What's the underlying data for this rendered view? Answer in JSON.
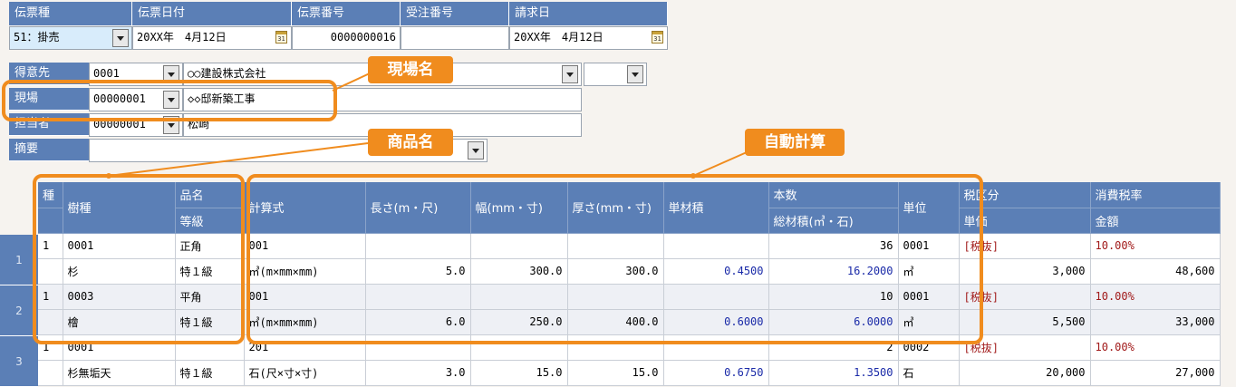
{
  "header": {
    "labels": [
      "伝票種",
      "伝票日付",
      "伝票番号",
      "受注番号",
      "請求日"
    ],
    "slip_type": "51：掛売",
    "slip_date": "20XX年　4月12日",
    "slip_number": "0000000016",
    "order_number": "",
    "billing_date": "20XX年　4月12日",
    "calendar_glyph": "31"
  },
  "info": {
    "customer_label": "得意先",
    "customer_code": "0001",
    "customer_name": "○○建設株式会社",
    "site_label": "現場",
    "site_code": "00000001",
    "site_name": "◇◇邸新築工事",
    "staff_label": "担当者",
    "staff_code": "00000001",
    "staff_name": "松崎",
    "memo_label": "摘要",
    "memo_value": ""
  },
  "grid": {
    "headers": {
      "kind": "種",
      "species": "樹種",
      "item_name": "品名",
      "grade": "等級",
      "formula": "計算式",
      "length": "長さ(m・尺)",
      "width": "幅(mm・寸)",
      "thickness": "厚さ(mm・寸)",
      "unit_volume": "単材積",
      "quantity": "本数",
      "total_volume": "総材積(㎥・石)",
      "unit": "単位",
      "tax_class": "税区分",
      "unit_price": "単価",
      "tax_rate": "消費税率",
      "amount": "金額"
    },
    "rows": [
      {
        "num": "1",
        "kind": "1",
        "code": "0001",
        "item_name": "正角",
        "formula_code": "001",
        "quantity": "36",
        "unit_code": "0001",
        "tax_class": "[税抜]",
        "tax_rate": "10.00%",
        "species": "杉",
        "grade": "特１級",
        "formula": "㎥(m×mm×mm)",
        "length": "5.0",
        "width": "300.0",
        "thickness": "300.0",
        "unit_volume": "0.4500",
        "total_volume": "16.2000",
        "unit": "㎥",
        "unit_price": "3,000",
        "amount": "48,600"
      },
      {
        "num": "2",
        "kind": "1",
        "code": "0003",
        "item_name": "平角",
        "formula_code": "001",
        "quantity": "10",
        "unit_code": "0001",
        "tax_class": "[税抜]",
        "tax_rate": "10.00%",
        "species": "檜",
        "grade": "特１級",
        "formula": "㎥(m×mm×mm)",
        "length": "6.0",
        "width": "250.0",
        "thickness": "400.0",
        "unit_volume": "0.6000",
        "total_volume": "6.0000",
        "unit": "㎥",
        "unit_price": "5,500",
        "amount": "33,000"
      },
      {
        "num": "3",
        "kind": "1",
        "code": "0001",
        "item_name": "",
        "formula_code": "201",
        "quantity": "2",
        "unit_code": "0002",
        "tax_class": "[税抜]",
        "tax_rate": "10.00%",
        "species": "杉無垢天",
        "grade": "特１級",
        "formula": "石(尺×寸×寸)",
        "length": "3.0",
        "width": "15.0",
        "thickness": "15.0",
        "unit_volume": "0.6750",
        "total_volume": "1.3500",
        "unit": "石",
        "unit_price": "20,000",
        "amount": "27,000"
      }
    ]
  },
  "annotations": {
    "site_name": "現場名",
    "product_name": "商品名",
    "auto_calc": "自動計算"
  },
  "colors": {
    "accent": "#f08c1e",
    "header_blue": "#5b7fb6",
    "value_blue": "#1a2aa8",
    "tax_red": "#a11a1a"
  }
}
